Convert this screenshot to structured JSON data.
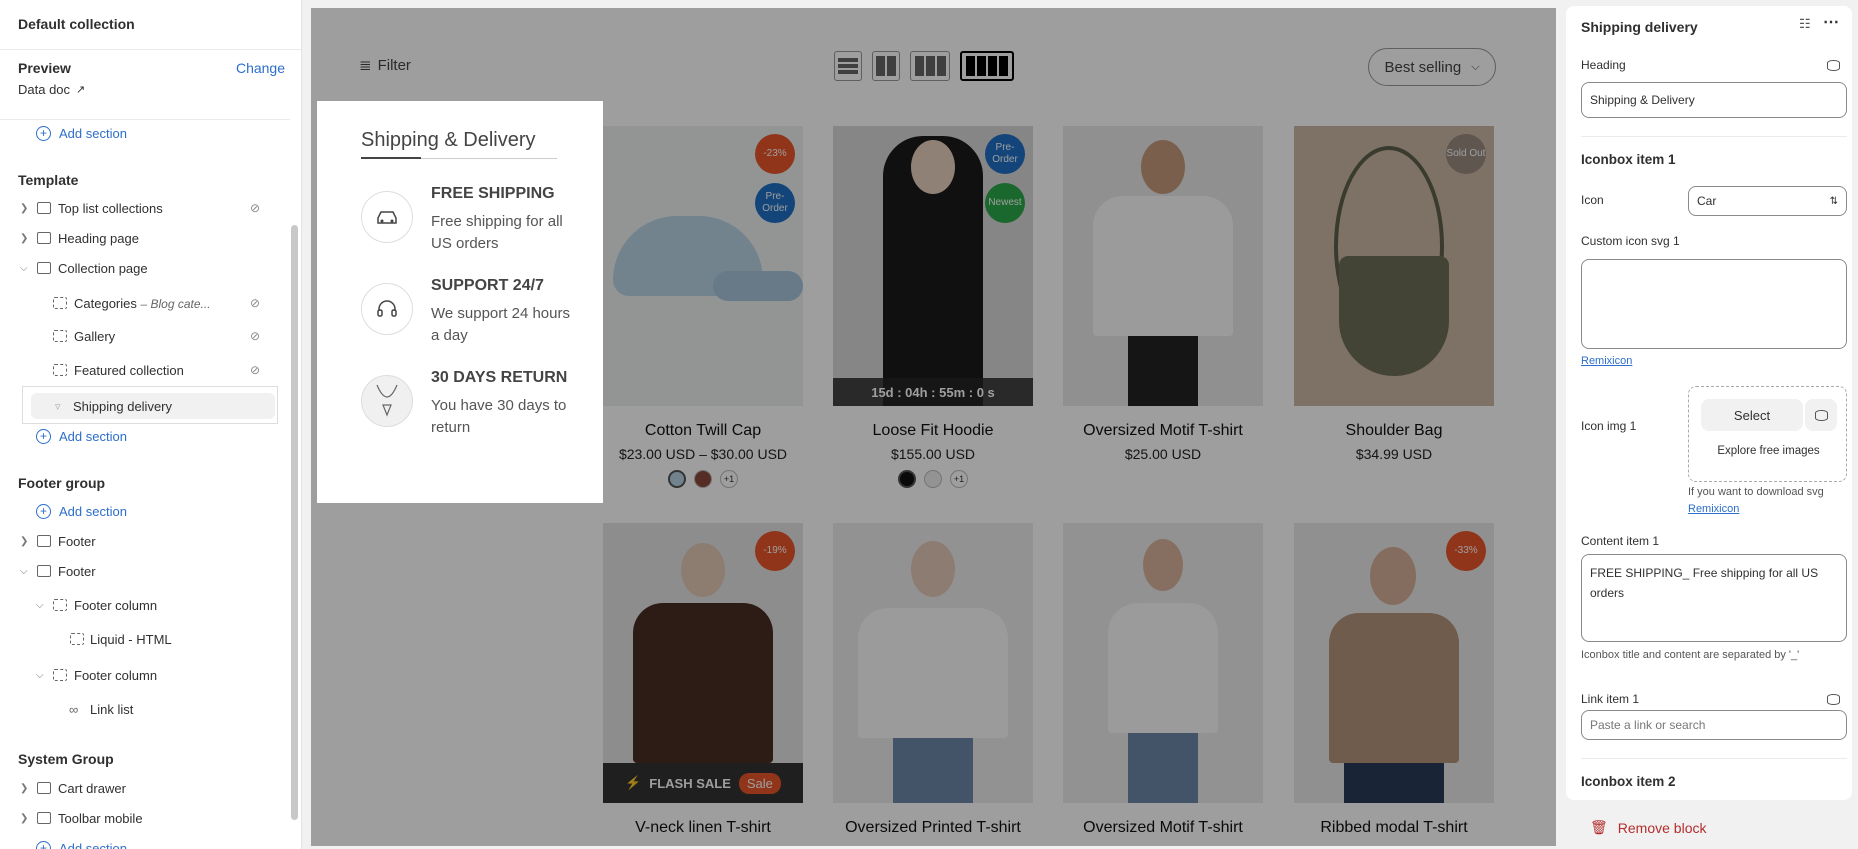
{
  "sidebar": {
    "title": "Default collection",
    "preview": {
      "label": "Preview",
      "change": "Change",
      "doc": "Data doc"
    },
    "add_section": "Add section",
    "template_title": "Template",
    "template_items": [
      {
        "label": "Top list collections"
      },
      {
        "label": "Heading page"
      },
      {
        "label": "Collection page"
      },
      {
        "label": "Categories",
        "sub": "– Blog cate..."
      },
      {
        "label": "Gallery"
      },
      {
        "label": "Featured collection"
      },
      {
        "label": "Shipping delivery"
      }
    ],
    "footer_title": "Footer group",
    "footer_items": [
      {
        "label": "Footer"
      },
      {
        "label": "Footer"
      },
      {
        "label": "Footer column"
      },
      {
        "label": "Liquid - HTML"
      },
      {
        "label": "Footer column"
      },
      {
        "label": "Link list"
      }
    ],
    "system_title": "System Group",
    "system_items": [
      {
        "label": "Cart drawer"
      },
      {
        "label": "Toolbar mobile"
      }
    ]
  },
  "canvas": {
    "filter": "Filter",
    "sort": "Best selling",
    "products": [
      {
        "name": "Cotton Twill Cap",
        "price": "$23.00 USD – $30.00 USD",
        "badges": [
          "-23%",
          "Pre-Order"
        ],
        "more": "+1"
      },
      {
        "name": "Loose Fit Hoodie",
        "price": "$155.00 USD",
        "badges": [
          "Pre-Order",
          "Newest"
        ],
        "timer": "15d : 04h : 55m : 0  s",
        "more": "+1"
      },
      {
        "name": "Oversized Motif T-shirt",
        "price": "$25.00 USD"
      },
      {
        "name": "Shoulder Bag",
        "price": "$34.99 USD",
        "badges": [
          "Sold Out"
        ]
      },
      {
        "name": "V-neck linen T-shirt",
        "badges": [
          "-19%"
        ],
        "flash": "FLASH SALE",
        "sale": "Sale"
      },
      {
        "name": "Oversized Printed T-shirt"
      },
      {
        "name": "Oversized Motif T-shirt"
      },
      {
        "name": "Ribbed modal T-shirt",
        "badges": [
          "-33%"
        ]
      }
    ]
  },
  "shipping": {
    "title": "Shipping & Delivery",
    "items": [
      {
        "title": "FREE SHIPPING",
        "desc": "Free shipping for all US orders",
        "icon": "car-icon"
      },
      {
        "title": "SUPPORT 24/7",
        "desc": "We support 24 hours a day",
        "icon": "headset-icon"
      },
      {
        "title": "30 DAYS RETURN",
        "desc": "You have 30 days to return",
        "icon": "necklace-icon"
      }
    ]
  },
  "panel": {
    "title": "Shipping delivery",
    "heading_label": "Heading",
    "heading_value": "Shipping & Delivery",
    "iconbox1": "Iconbox item 1",
    "icon_label": "Icon",
    "icon_value": "Car",
    "custom_icon_label": "Custom icon svg 1",
    "remixicon": "Remixicon",
    "icon_img_label": "Icon img 1",
    "select": "Select",
    "explore": "Explore free images",
    "download_hint": "If you want to download svg",
    "content_label": "Content item 1",
    "content_value": "FREE SHIPPING_ Free shipping for all US orders",
    "content_hint": "Iconbox title and content are separated by '_'",
    "link_label": "Link item 1",
    "link_placeholder": "Paste a link or search",
    "iconbox2": "Iconbox item 2",
    "remove": "Remove block"
  },
  "colors": {
    "accent": "#2c6ecb",
    "badge_red": "#e8552a",
    "badge_blue": "#1f6fc5",
    "badge_green": "#2aa84a",
    "danger": "#b52d2d"
  }
}
